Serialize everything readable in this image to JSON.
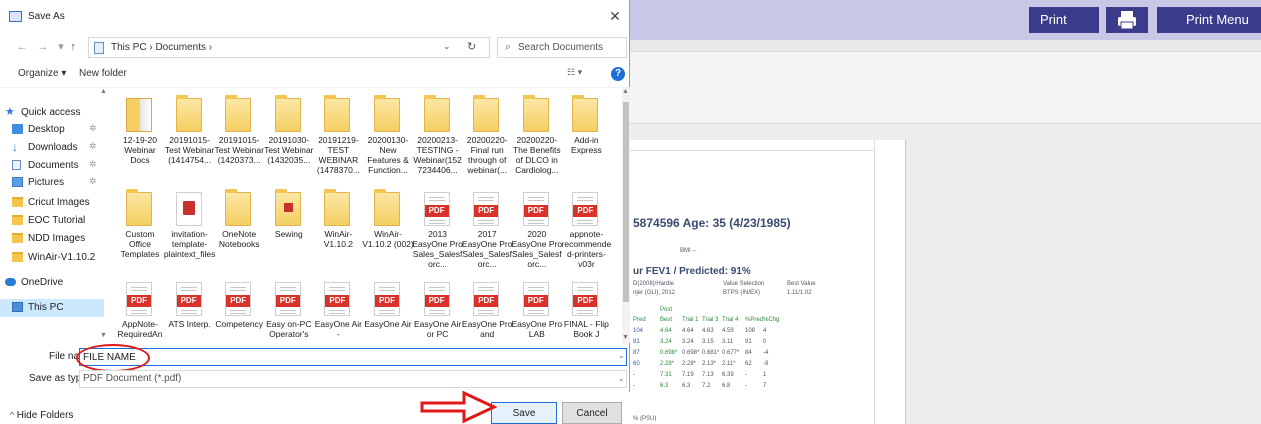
{
  "background_app": {
    "print_label": "Print",
    "print_menu_label": "Print Menu",
    "report": {
      "patient_line": "5874596   Age: 35 (4/23/1985)",
      "bmi": "BMI  --",
      "fev_line": "ur FEV1 / Predicted: 91%",
      "ref_line1": "D(2008)/Hardie",
      "ref_line2": "njer (GLI), 2012",
      "value_selection_label": "Value Selection",
      "value_selection": "BTPS (IN/EX)",
      "best_value_label": "Best Value",
      "best_value": "1.11/1.02",
      "post_label": "Post",
      "table_headers": [
        "Pred",
        "Best",
        "Trial 1",
        "Trial 3",
        "Trial 4",
        "%Pred",
        "%Chg"
      ],
      "table_rows": [
        [
          "104",
          "4.64",
          "4.64",
          "4.63",
          "4.59",
          "108",
          "4"
        ],
        [
          "91",
          "3.24",
          "3.24",
          "3.15",
          "3.11",
          "91",
          "0"
        ],
        [
          "87",
          "0.698*",
          "0.698*",
          "0.681*",
          "0.677*",
          "84",
          "-4"
        ],
        [
          "60",
          "2.28*",
          "2.28*",
          "2.13*",
          "2.11*",
          "62",
          "-9"
        ],
        [
          "-",
          "7.31",
          "7.19",
          "7.13",
          "6.39",
          "-",
          "1"
        ],
        [
          "-",
          "6.3",
          "6.3",
          "7.2",
          "6.8",
          "-",
          "7"
        ]
      ],
      "footer_text": "% (PSU)"
    }
  },
  "dialog": {
    "title": "Save As",
    "close_glyph": "✕",
    "nav": {
      "back_glyph": "←",
      "forward_glyph": "→",
      "up_glyph": "↑",
      "address": "This PC  ›  Documents  ›",
      "refresh_glyph": "↻",
      "search_placeholder": "Search Documents"
    },
    "commands": {
      "organize": "Organize ▾",
      "new_folder": "New folder",
      "view_glyph": "☷ ▾",
      "help_glyph": "?"
    },
    "nav_pane": [
      {
        "label": "Quick access",
        "icon": "star-icon",
        "pinned": false
      },
      {
        "label": "Desktop",
        "icon": "desktop-icon",
        "pinned": true
      },
      {
        "label": "Downloads",
        "icon": "download-icon",
        "pinned": true
      },
      {
        "label": "Documents",
        "icon": "documents-icon",
        "pinned": true
      },
      {
        "label": "Pictures",
        "icon": "pictures-icon",
        "pinned": true
      },
      {
        "label": "Cricut Images",
        "icon": "folder-icon",
        "pinned": false
      },
      {
        "label": "EOC Tutorial",
        "icon": "folder-icon",
        "pinned": false
      },
      {
        "label": "NDD Images",
        "icon": "folder-icon",
        "pinned": false
      },
      {
        "label": "WinAir-V1.10.2",
        "icon": "folder-icon",
        "pinned": false
      },
      {
        "label": "OneDrive",
        "icon": "cloud-icon",
        "pinned": false
      },
      {
        "label": "This PC",
        "icon": "pc-icon",
        "pinned": false
      }
    ],
    "files": [
      {
        "label": "12-19-20 Webinar Docs",
        "icon": "folder-doc"
      },
      {
        "label": "20191015-Test Webinar (1414754...",
        "icon": "folder"
      },
      {
        "label": "20191015-Test Webinar (1420373...",
        "icon": "folder"
      },
      {
        "label": "20191030-Test Webinar (1432035...",
        "icon": "folder"
      },
      {
        "label": "20191219-TEST WEBINAR (1478370...",
        "icon": "folder"
      },
      {
        "label": "20200130-New Features & Function...",
        "icon": "folder"
      },
      {
        "label": "20200213-TESTING - Webinar(1527234406...",
        "icon": "folder"
      },
      {
        "label": "20200220-Final run through of webinar(...",
        "icon": "folder"
      },
      {
        "label": "20200220-The Benefits of DLCO in Cardiolog...",
        "icon": "folder"
      },
      {
        "label": "Add-in Express",
        "icon": "folder"
      },
      {
        "label": "Custom Office Templates",
        "icon": "folder"
      },
      {
        "label": "invitation-template-plaintext_files",
        "icon": "doc-red"
      },
      {
        "label": "OneNote Notebooks",
        "icon": "folder"
      },
      {
        "label": "Sewing",
        "icon": "folder-red"
      },
      {
        "label": "WinAir-V1.10.2",
        "icon": "folder"
      },
      {
        "label": "WinAir-V1.10.2 (002)",
        "icon": "folder"
      },
      {
        "label": "2013 EasyOne Pro Sales_Salesforc...",
        "icon": "pdf"
      },
      {
        "label": "2017 EasyOne Pro Sales_Salesforc...",
        "icon": "pdf"
      },
      {
        "label": "2020 EasyOne Pro Sales_Salesforc...",
        "icon": "pdf"
      },
      {
        "label": "appnote-recommended-printers-v03r",
        "icon": "pdf"
      },
      {
        "label": "AppNote-RequiredAn",
        "icon": "pdf"
      },
      {
        "label": "ATS Interp.",
        "icon": "pdf"
      },
      {
        "label": "Competency",
        "icon": "pdf"
      },
      {
        "label": "Easy on-PC Operator's",
        "icon": "pdf"
      },
      {
        "label": "EasyOne Air -",
        "icon": "pdf"
      },
      {
        "label": "EasyOne Air",
        "icon": "pdf"
      },
      {
        "label": "EasyOne Air or PC",
        "icon": "pdf"
      },
      {
        "label": "EasyOne Pro and",
        "icon": "pdf"
      },
      {
        "label": "EasyOne Pro LAB",
        "icon": "pdf"
      },
      {
        "label": "FINAL - Flip Book J",
        "icon": "pdf"
      }
    ],
    "file_name_label": "File name:",
    "file_name_value": "FILE NAME",
    "save_type_label": "Save as type:",
    "save_type_value": "PDF Document (*.pdf)",
    "hide_folders": "Hide Folders",
    "save_label": "Save",
    "cancel_label": "Cancel"
  },
  "colors": {
    "accent": "#1e6fd9",
    "app_button": "#3b3b8c",
    "highlight_red": "#e01818",
    "pdf_red": "#d9322b"
  }
}
